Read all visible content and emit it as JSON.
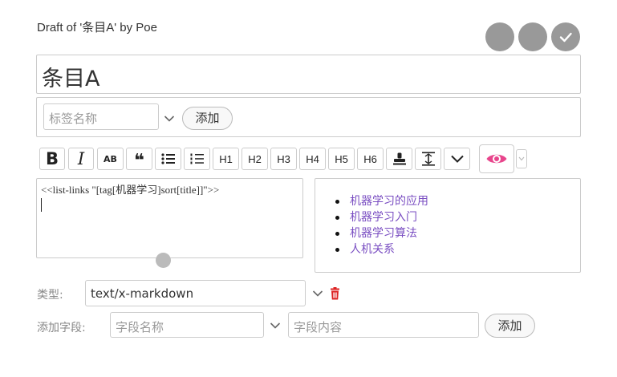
{
  "header": {
    "draft_title": "Draft of '条目A' by Poe"
  },
  "title_field": {
    "value": "条目A"
  },
  "tags": {
    "input_placeholder": "标签名称",
    "add_label": "添加"
  },
  "toolbar": {
    "bold": "B",
    "italic": "I",
    "smallcaps": "AB",
    "quote": "❝",
    "h1": "H1",
    "h2": "H2",
    "h3": "H3",
    "h4": "H4",
    "h5": "H5",
    "h6": "H6"
  },
  "editor": {
    "text": "<<list-links \"[tag[机器学习]sort[title]]\">>"
  },
  "preview": {
    "items": [
      "机器学习的应用",
      "机器学习入门",
      "机器学习算法",
      "人机关系"
    ]
  },
  "type_field": {
    "label": "类型:",
    "value": "text/x-markdown"
  },
  "add_field": {
    "label": "添加字段:",
    "name_placeholder": "字段名称",
    "value_placeholder": "字段内容",
    "add_label": "添加"
  },
  "colors": {
    "accent": "#e8458c",
    "link": "#7a4ec2",
    "delete": "#dd2222",
    "round_button": "#999999"
  },
  "icons": [
    "delete-icon",
    "cancel-icon",
    "confirm-check-icon",
    "preview-eye-icon",
    "chevron-down-icon"
  ]
}
